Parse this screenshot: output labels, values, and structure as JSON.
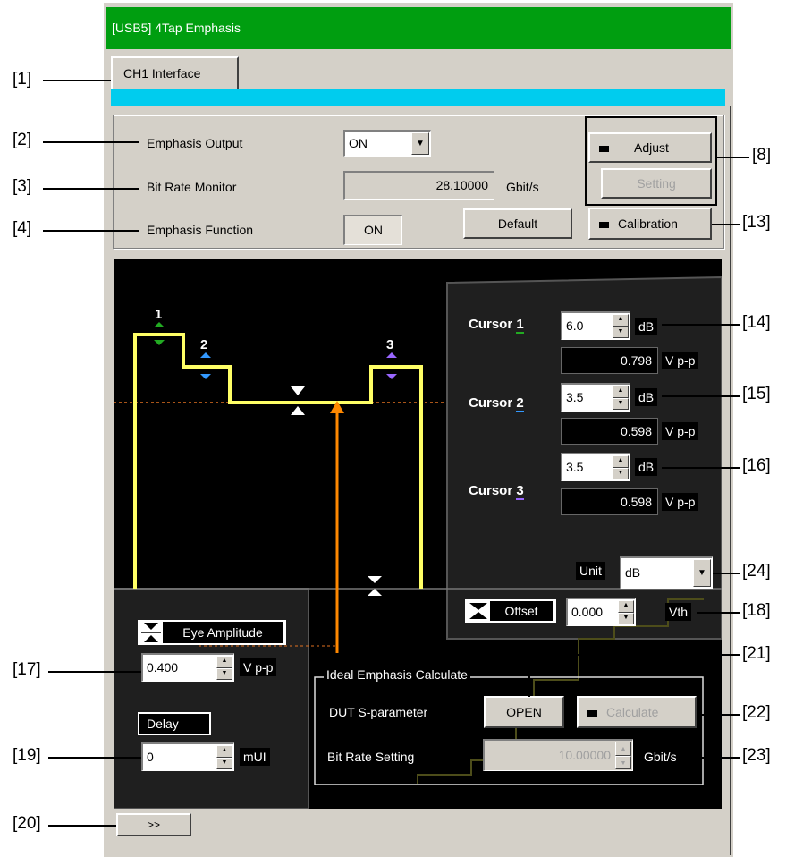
{
  "window": {
    "title": "[USB5] 4Tap Emphasis"
  },
  "tab": {
    "label": "CH1 Interface"
  },
  "callouts": [
    "[1]",
    "[2]",
    "[3]",
    "[4]",
    "[8]",
    "[13]",
    "[14]",
    "[15]",
    "[16]",
    "[24]",
    "[18]",
    "[17]",
    "[21]",
    "[22]",
    "[19]",
    "[23]",
    "[20]"
  ],
  "settings": {
    "emphasis_output_label": "Emphasis Output",
    "emphasis_output_value": "ON",
    "bit_rate_monitor_label": "Bit Rate Monitor",
    "bit_rate_monitor_value": "28.10000",
    "bit_rate_unit": "Gbit/s",
    "emphasis_function_label": "Emphasis Function",
    "emphasis_function_value": "ON",
    "default_label": "Default",
    "adjust_label": "Adjust",
    "setting_label": "Setting",
    "calibration_label": "Calibration"
  },
  "cursors": [
    {
      "label": "Cursor",
      "num": "1",
      "db": "6.0",
      "db_unit": "dB",
      "vpp": "0.798",
      "vpp_unit": "V p-p",
      "color": "#22aa22"
    },
    {
      "label": "Cursor",
      "num": "2",
      "db": "3.5",
      "db_unit": "dB",
      "vpp": "0.598",
      "vpp_unit": "V p-p",
      "color": "#3399ff"
    },
    {
      "label": "Cursor",
      "num": "3",
      "db": "3.5",
      "db_unit": "dB",
      "vpp": "0.598",
      "vpp_unit": "V p-p",
      "color": "#9966ff"
    }
  ],
  "waveform": {
    "marker1": "1",
    "marker2": "2",
    "marker3": "3"
  },
  "unit": {
    "label": "Unit",
    "value": "dB"
  },
  "offset": {
    "label": "Offset",
    "value": "0.000",
    "unit": "Vth"
  },
  "eye": {
    "label": "Eye Amplitude",
    "value": "0.400",
    "unit": "V p-p"
  },
  "delay": {
    "label": "Delay",
    "value": "0",
    "unit": "mUI"
  },
  "ideal": {
    "group_label": "Ideal Emphasis Calculate",
    "dut_label": "DUT S-parameter",
    "open_label": "OPEN",
    "calculate_label": "Calculate",
    "bitrate_label": "Bit Rate Setting",
    "bitrate_value": "10.00000",
    "bitrate_unit": "Gbit/s"
  },
  "expand": {
    "label": ">>"
  }
}
